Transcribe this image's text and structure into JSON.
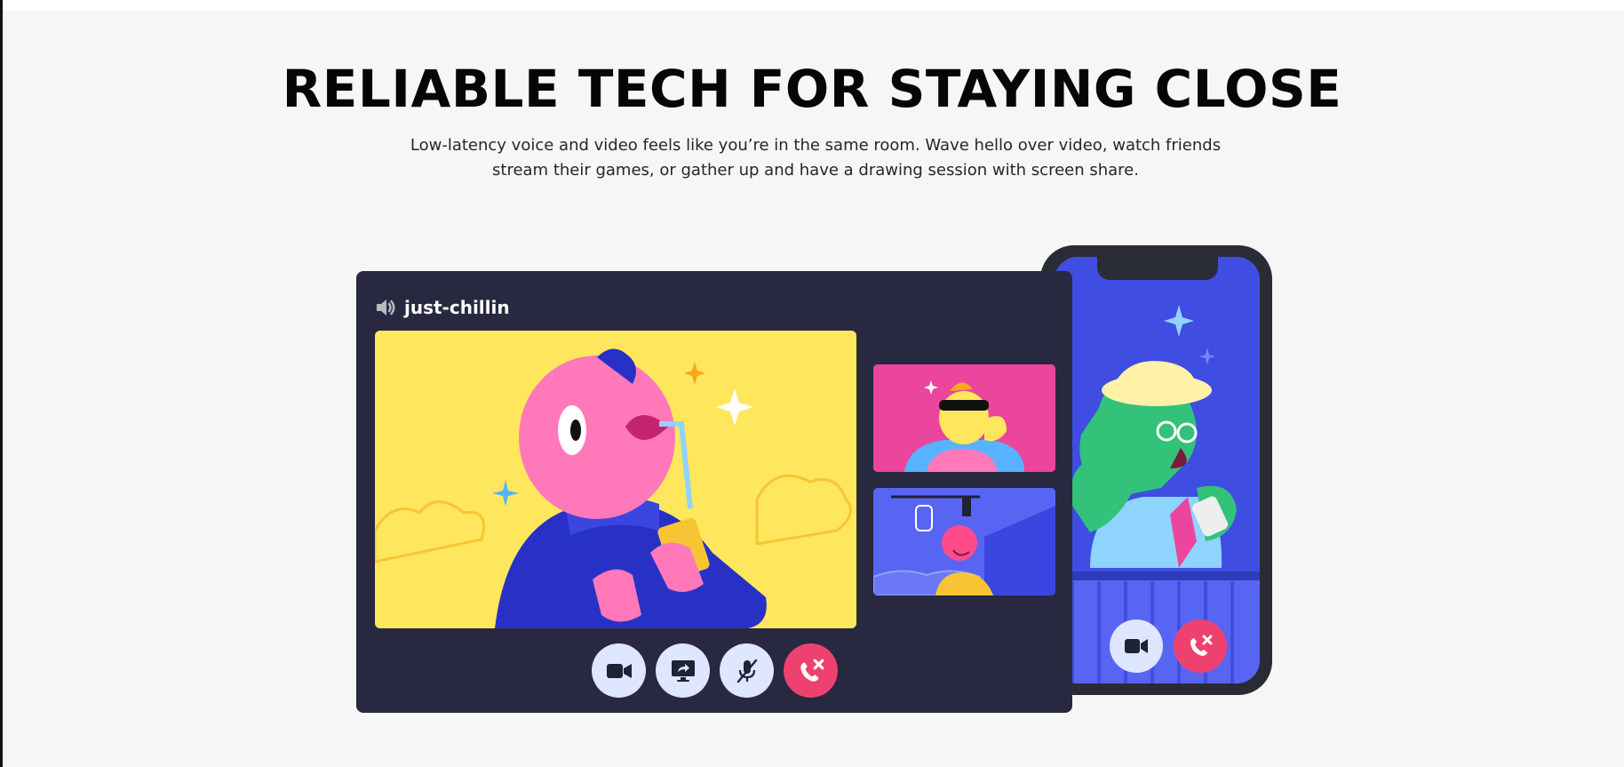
{
  "section": {
    "headline": "RELIABLE TECH FOR STAYING CLOSE",
    "subcopy": "Low-latency voice and video feels like you’re in the same room. Wave hello over video, watch friends stream their games, or gather up and have a drawing session with screen share."
  },
  "call": {
    "channel_icon": "speaker-icon",
    "channel_name": "just-chillin",
    "controls": [
      {
        "icon": "video-camera-icon"
      },
      {
        "icon": "screen-share-icon"
      },
      {
        "icon": "microphone-muted-icon"
      },
      {
        "icon": "hang-up-icon"
      }
    ]
  },
  "phone": {
    "controls": [
      {
        "icon": "video-camera-icon"
      },
      {
        "icon": "hang-up-icon"
      }
    ]
  },
  "colors": {
    "page_bg": "#f6f6f6",
    "window_bg": "#282840",
    "control_bg": "#dfe6ff",
    "danger": "#ed4270",
    "yellow": "#fee75c",
    "pink": "#eb459e",
    "blurple": "#5865f2"
  }
}
